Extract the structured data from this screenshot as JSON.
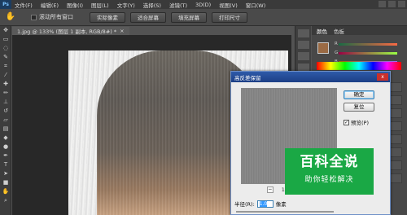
{
  "app": {
    "logo": "Ps"
  },
  "menu": [
    "文件(F)",
    "编辑(E)",
    "图像(I)",
    "图层(L)",
    "文字(Y)",
    "选择(S)",
    "滤镜(T)",
    "3D(D)",
    "视图(V)",
    "窗口(W)"
  ],
  "options": {
    "hand_icon": "hand-icon",
    "scroll_all_label": "滚动所有窗口",
    "buttons": [
      "实际像素",
      "适合屏幕",
      "填充屏幕",
      "打印尺寸"
    ]
  },
  "document": {
    "tab_title": "1.jpg @ 133% (图层 1 副本, RGB/8#) *",
    "close": "×"
  },
  "panel": {
    "tabs": [
      "颜色",
      "色板"
    ],
    "r": "R",
    "g": "G",
    "b": "B"
  },
  "dialog": {
    "title": "高反差保留",
    "close": "x",
    "ok_label": "确定",
    "cancel_label": "复位",
    "preview_label": "预览(P)",
    "preview_checked": "✓",
    "zoom_out": "−",
    "zoom_in": "+",
    "zoom_level": "100%",
    "radius_label": "半径(R):",
    "radius_value": "1.0",
    "radius_unit": "像素"
  },
  "watermark": {
    "line1": "百科全说",
    "line2": "助你轻松解决"
  },
  "colors": {
    "accent": "#2e5aa8",
    "watermark": "#1aa845",
    "foreground": "#9a6a44"
  }
}
